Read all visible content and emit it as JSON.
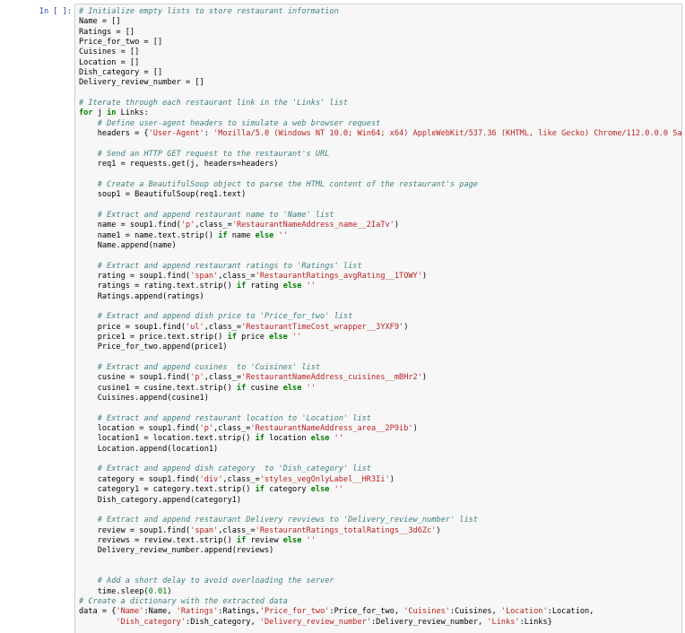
{
  "prompt": "In [ ]:",
  "lines": [
    [
      [
        "c",
        "# Initialize empty lists to store restaurant information"
      ]
    ],
    [
      [
        "p",
        "Name = []"
      ]
    ],
    [
      [
        "p",
        "Ratings = []"
      ]
    ],
    [
      [
        "p",
        "Price_for_two = []"
      ]
    ],
    [
      [
        "p",
        "Cuisines = []"
      ]
    ],
    [
      [
        "p",
        "Location = []"
      ]
    ],
    [
      [
        "p",
        "Dish_category = []"
      ]
    ],
    [
      [
        "p",
        "Delivery_review_number = []"
      ]
    ],
    [],
    [
      [
        "c",
        "# Iterate through each restaurant link in the 'Links' list"
      ]
    ],
    [
      [
        "k",
        "for"
      ],
      [
        "p",
        " j "
      ],
      [
        "k",
        "in"
      ],
      [
        "p",
        " Links:"
      ]
    ],
    [
      [
        "p",
        "    "
      ],
      [
        "c",
        "# Define user-agent headers to simulate a web browser request"
      ]
    ],
    [
      [
        "p",
        "    headers = {"
      ],
      [
        "s",
        "'User-Agent'"
      ],
      [
        "p",
        ": "
      ],
      [
        "s",
        "'Mozilla/5.0 (Windows NT 10.0; Win64; x64) AppleWebKit/537.36 (KHTML, like Gecko) Chrome/112.0.0.0 Sa"
      ]
    ],
    [],
    [
      [
        "p",
        "    "
      ],
      [
        "c",
        "# Send an HTTP GET request to the restaurant's URL"
      ]
    ],
    [
      [
        "p",
        "    req1 = requests.get(j, headers=headers)"
      ]
    ],
    [],
    [
      [
        "p",
        "    "
      ],
      [
        "c",
        "# Create a BeautifulSoup object to parse the HTML content of the restaurant's page"
      ]
    ],
    [
      [
        "p",
        "    soup1 = BeautifulSoup(req1.text)"
      ]
    ],
    [],
    [
      [
        "p",
        "    "
      ],
      [
        "c",
        "# Extract and append restaurant name to 'Name' list"
      ]
    ],
    [
      [
        "p",
        "    name = soup1.find("
      ],
      [
        "s",
        "'p'"
      ],
      [
        "p",
        ",class_="
      ],
      [
        "s",
        "'RestaurantNameAddress_name__2IaTv'"
      ],
      [
        "p",
        ")"
      ]
    ],
    [
      [
        "p",
        "    name1 = name.text.strip() "
      ],
      [
        "k",
        "if"
      ],
      [
        "p",
        " name "
      ],
      [
        "k",
        "else"
      ],
      [
        "p",
        " "
      ],
      [
        "s",
        "''"
      ]
    ],
    [
      [
        "p",
        "    Name.append(name)"
      ]
    ],
    [],
    [
      [
        "p",
        "    "
      ],
      [
        "c",
        "# Extract and append restaurant ratings to 'Ratings' list"
      ]
    ],
    [
      [
        "p",
        "    rating = soup1.find("
      ],
      [
        "s",
        "'span'"
      ],
      [
        "p",
        ",class_="
      ],
      [
        "s",
        "'RestaurantRatings_avgRating__1TOWY'"
      ],
      [
        "p",
        ")"
      ]
    ],
    [
      [
        "p",
        "    ratings = rating.text.strip() "
      ],
      [
        "k",
        "if"
      ],
      [
        "p",
        " rating "
      ],
      [
        "k",
        "else"
      ],
      [
        "p",
        " "
      ],
      [
        "s",
        "''"
      ]
    ],
    [
      [
        "p",
        "    Ratings.append(ratings)"
      ]
    ],
    [],
    [
      [
        "p",
        "    "
      ],
      [
        "c",
        "# Extract and append dish price to 'Price_for_two' list"
      ]
    ],
    [
      [
        "p",
        "    price = soup1.find("
      ],
      [
        "s",
        "'ul'"
      ],
      [
        "p",
        ",class_="
      ],
      [
        "s",
        "'RestaurantTimeCost_wrapper__3YXF9'"
      ],
      [
        "p",
        ")"
      ]
    ],
    [
      [
        "p",
        "    price1 = price.text.strip() "
      ],
      [
        "k",
        "if"
      ],
      [
        "p",
        " price "
      ],
      [
        "k",
        "else"
      ],
      [
        "p",
        " "
      ],
      [
        "s",
        "''"
      ]
    ],
    [
      [
        "p",
        "    Price_for_two.append(price1)"
      ]
    ],
    [],
    [
      [
        "p",
        "    "
      ],
      [
        "c",
        "# Extract and append cusines  to 'Cuisines' list"
      ]
    ],
    [
      [
        "p",
        "    cusine = soup1.find("
      ],
      [
        "s",
        "'p'"
      ],
      [
        "p",
        ",class_="
      ],
      [
        "s",
        "'RestaurantNameAddress_cuisines__mBHr2'"
      ],
      [
        "p",
        ")"
      ]
    ],
    [
      [
        "p",
        "    cusine1 = cusine.text.strip() "
      ],
      [
        "k",
        "if"
      ],
      [
        "p",
        " cusine "
      ],
      [
        "k",
        "else"
      ],
      [
        "p",
        " "
      ],
      [
        "s",
        "''"
      ]
    ],
    [
      [
        "p",
        "    Cuisines.append(cusine1)"
      ]
    ],
    [],
    [
      [
        "p",
        "    "
      ],
      [
        "c",
        "# Extract and append restaurant location to 'Location' list"
      ]
    ],
    [
      [
        "p",
        "    location = soup1.find("
      ],
      [
        "s",
        "'p'"
      ],
      [
        "p",
        ",class_="
      ],
      [
        "s",
        "'RestaurantNameAddress_area__2P9ib'"
      ],
      [
        "p",
        ")"
      ]
    ],
    [
      [
        "p",
        "    location1 = location.text.strip() "
      ],
      [
        "k",
        "if"
      ],
      [
        "p",
        " location "
      ],
      [
        "k",
        "else"
      ],
      [
        "p",
        " "
      ],
      [
        "s",
        "''"
      ]
    ],
    [
      [
        "p",
        "    Location.append(location1)"
      ]
    ],
    [],
    [
      [
        "p",
        "    "
      ],
      [
        "c",
        "# Extract and append dish category  to 'Dish_category' list"
      ]
    ],
    [
      [
        "p",
        "    category = soup1.find("
      ],
      [
        "s",
        "'div'"
      ],
      [
        "p",
        ",class_="
      ],
      [
        "s",
        "'styles_vegOnlyLabel__HR3Ii'"
      ],
      [
        "p",
        ")"
      ]
    ],
    [
      [
        "p",
        "    category1 = category.text.strip() "
      ],
      [
        "k",
        "if"
      ],
      [
        "p",
        " category "
      ],
      [
        "k",
        "else"
      ],
      [
        "p",
        " "
      ],
      [
        "s",
        "''"
      ]
    ],
    [
      [
        "p",
        "    Dish_category.append(category1)"
      ]
    ],
    [],
    [
      [
        "p",
        "    "
      ],
      [
        "c",
        "# Extract and append restaurant Delivery revviews to 'Delivery_review_number' list"
      ]
    ],
    [
      [
        "p",
        "    review = soup1.find("
      ],
      [
        "s",
        "'span'"
      ],
      [
        "p",
        ",class_="
      ],
      [
        "s",
        "'RestaurantRatings_totalRatings__3d6Zc'"
      ],
      [
        "p",
        ")"
      ]
    ],
    [
      [
        "p",
        "    reviews = review.text.strip() "
      ],
      [
        "k",
        "if"
      ],
      [
        "p",
        " review "
      ],
      [
        "k",
        "else"
      ],
      [
        "p",
        " "
      ],
      [
        "s",
        "''"
      ]
    ],
    [
      [
        "p",
        "    Delivery_review_number.append(reviews)"
      ]
    ],
    [],
    [],
    [
      [
        "p",
        "    "
      ],
      [
        "c",
        "# Add a short delay to avoid overloading the server"
      ]
    ],
    [
      [
        "p",
        "    time.sleep("
      ],
      [
        "m",
        "0.01"
      ],
      [
        "p",
        ")"
      ]
    ],
    [
      [
        "c",
        "# Create a dictionary with the extracted data"
      ]
    ],
    [
      [
        "p",
        "data = {"
      ],
      [
        "s",
        "'Name'"
      ],
      [
        "p",
        ":Name, "
      ],
      [
        "s",
        "'Ratings'"
      ],
      [
        "p",
        ":Ratings,"
      ],
      [
        "s",
        "'Price_for_two'"
      ],
      [
        "p",
        ":Price_for_two, "
      ],
      [
        "s",
        "'Cuisines'"
      ],
      [
        "p",
        ":Cuisines, "
      ],
      [
        "s",
        "'Location'"
      ],
      [
        "p",
        ":Location,"
      ]
    ],
    [
      [
        "p",
        "        "
      ],
      [
        "s",
        "'Dish_category'"
      ],
      [
        "p",
        ":Dish_category, "
      ],
      [
        "s",
        "'Delivery_review_number'"
      ],
      [
        "p",
        ":Delivery_review_number, "
      ],
      [
        "s",
        "'Links'"
      ],
      [
        "p",
        ":Links}"
      ]
    ]
  ]
}
